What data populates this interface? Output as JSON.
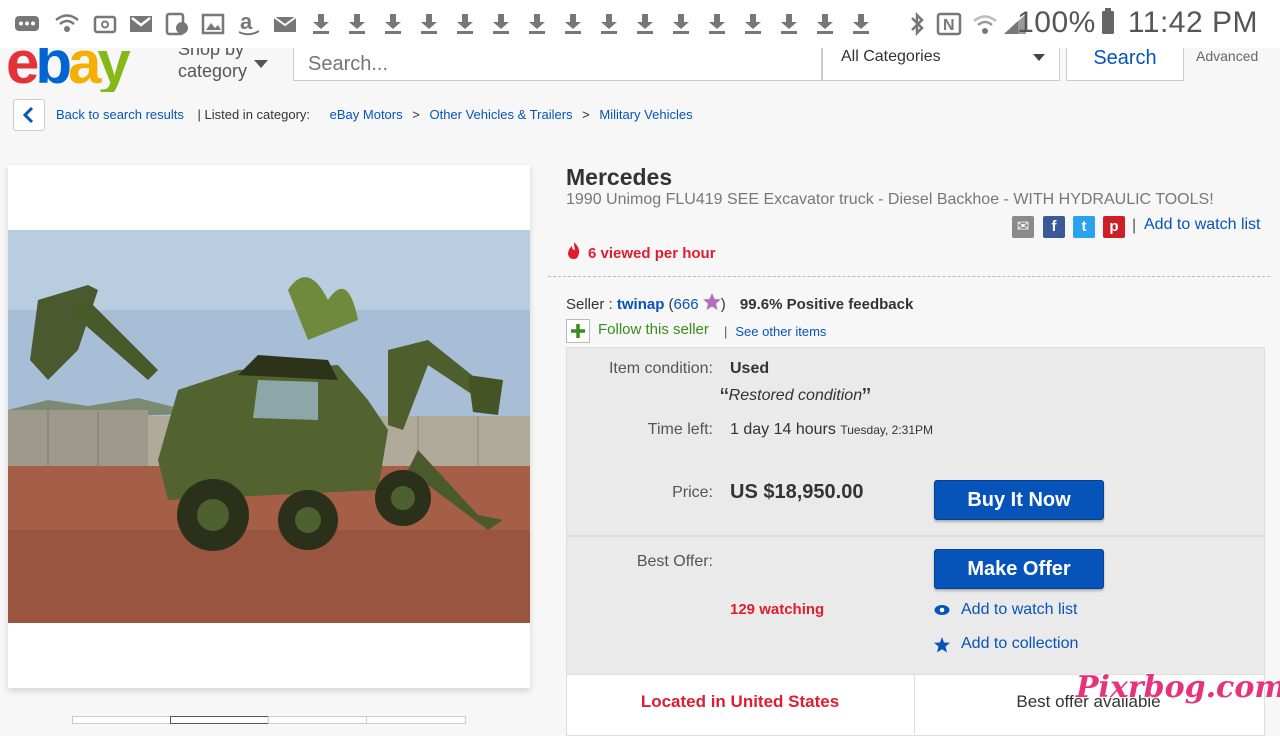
{
  "status_bar": {
    "battery": "100%",
    "time": "11:42 PM",
    "download_count": 16
  },
  "header": {
    "logo": [
      "e",
      "b",
      "a",
      "y"
    ],
    "logo_colors": [
      "#e53238",
      "#0064d2",
      "#f5af02",
      "#86b817"
    ],
    "shop_by_line1": "Shop by",
    "shop_by_line2": "category",
    "search_placeholder": "Search...",
    "category": "All Categories",
    "search_button": "Search",
    "advanced": "Advanced"
  },
  "breadcrumb": {
    "back": "Back to search results",
    "listed_in": "| Listed in category:",
    "items": [
      "eBay Motors",
      "Other Vehicles & Trailers",
      "Military Vehicles"
    ],
    "separator": ">"
  },
  "listing": {
    "brand": "Mercedes",
    "subtitle": "1990 Unimog FLU419 SEE Excavator truck - Diesel Backhoe - WITH HYDRAULIC TOOLS!",
    "add_to_watch_top": "Add to watch list",
    "viewed": "6 viewed per hour",
    "seller_label": "Seller :",
    "seller_name": "twinap",
    "seller_feedback_count": "666",
    "positive_feedback": "99.6% Positive feedback",
    "follow": "Follow this seller",
    "see_other": "See other items",
    "condition_label": "Item condition:",
    "condition_value": "Used",
    "condition_note": "Restored condition",
    "time_left_label": "Time left:",
    "time_left_value": "1 day 14 hours",
    "time_left_day": "Tuesday, 2:31PM",
    "price_label": "Price:",
    "price_value": "US $18,950.00",
    "buy_button": "Buy It Now",
    "best_offer_label": "Best Offer:",
    "offer_button": "Make Offer",
    "watching": "129 watching",
    "add_to_watch": "Add to watch list",
    "add_to_collection": "Add to collection",
    "located": "Located in United States",
    "best_offer_available": "Best offer available"
  },
  "share_icons": [
    "email-icon",
    "facebook-icon",
    "twitter-icon",
    "pinterest-icon"
  ],
  "watermark": "Pixrbog.com"
}
